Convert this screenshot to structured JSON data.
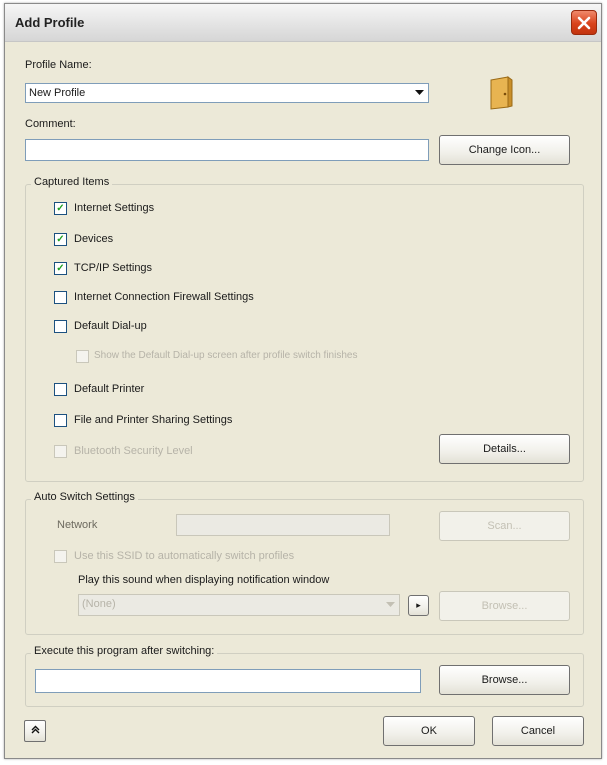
{
  "window": {
    "title": "Add Profile"
  },
  "profile_name": {
    "label": "Profile Name:",
    "value": "New Profile"
  },
  "comment": {
    "label": "Comment:",
    "value": "",
    "change_icon_button": "Change Icon..."
  },
  "captured_items": {
    "title": "Captured Items",
    "items": [
      {
        "label": "Internet Settings",
        "checked": true,
        "enabled": true
      },
      {
        "label": "Devices",
        "checked": true,
        "enabled": true
      },
      {
        "label": "TCP/IP Settings",
        "checked": true,
        "enabled": true
      },
      {
        "label": "Internet Connection Firewall Settings",
        "checked": false,
        "enabled": true
      },
      {
        "label": "Default Dial-up",
        "checked": false,
        "enabled": true
      },
      {
        "label": "Show the Default Dial-up screen after profile switch finishes",
        "checked": false,
        "enabled": false
      },
      {
        "label": "Default Printer",
        "checked": false,
        "enabled": true
      },
      {
        "label": "File and Printer Sharing Settings",
        "checked": false,
        "enabled": true
      },
      {
        "label": "Bluetooth Security Level",
        "checked": false,
        "enabled": false
      }
    ],
    "details_button": "Details..."
  },
  "auto_switch": {
    "title": "Auto Switch Settings",
    "network_label": "Network",
    "network_value": "",
    "scan_button": "Scan...",
    "ssid_checkbox_label": "Use this SSID to automatically switch profiles",
    "sound_label": "Play this sound when displaying notification window",
    "sound_value": "(None)",
    "play_button": "▸",
    "browse_button": "Browse..."
  },
  "execute": {
    "title": "Execute this program after switching:",
    "value": "",
    "browse_button": "Browse..."
  },
  "footer": {
    "collapse_button": "«",
    "ok_button": "OK",
    "cancel_button": "Cancel"
  },
  "icons": {
    "profile_icon": "folder-door-icon",
    "close_icon": "close-icon"
  }
}
